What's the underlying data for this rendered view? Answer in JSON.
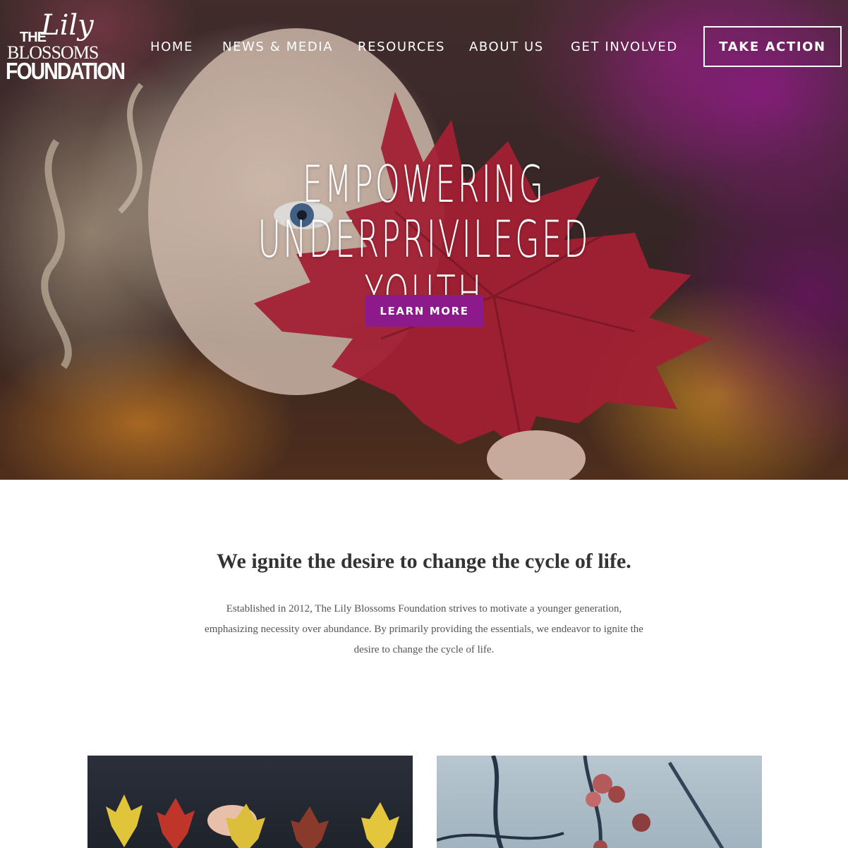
{
  "brand": {
    "logo_the": "THE",
    "logo_lily": "Lily",
    "logo_blossoms": "BLOSSOMS",
    "logo_foundation": "FOUNDATION"
  },
  "nav": {
    "items": [
      {
        "label": "HOME"
      },
      {
        "label": "NEWS & MEDIA"
      },
      {
        "label": "RESOURCES"
      },
      {
        "label": "ABOUT US"
      },
      {
        "label": "GET INVOLVED"
      }
    ],
    "cta_label": "TAKE ACTION"
  },
  "hero": {
    "title": "EMPOWERING UNDERPRIVILEGED YOUTH",
    "button_label": "LEARN MORE"
  },
  "main": {
    "tagline": "We ignite the desire to change the cycle of life.",
    "intro": "Established in 2012, The Lily Blossoms Foundation strives to motivate a younger generation, emphasizing necessity over abundance.  By primarily providing the essentials, we endeavor to ignite the desire to change the cycle of life."
  },
  "colors": {
    "accent": "#8c1a8a",
    "text_dark": "#333333",
    "text_body": "#555555"
  }
}
